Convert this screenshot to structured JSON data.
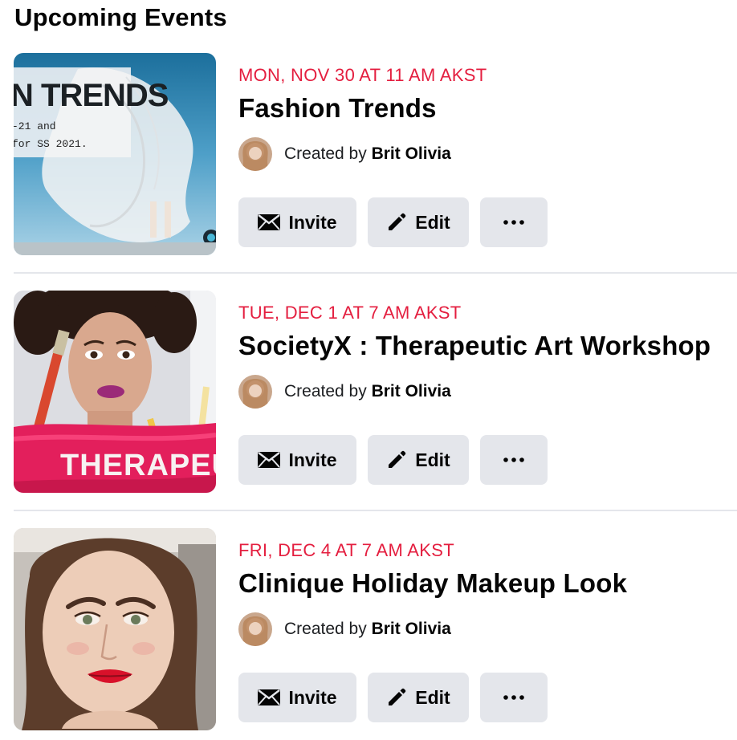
{
  "page": {
    "title": "Upcoming Events"
  },
  "events": [
    {
      "date": "MON, NOV 30 AT 11 AM AKST",
      "title": "Fashion Trends",
      "creator_prefix": "Created by ",
      "creator_name": "Brit Olivia",
      "thumb_text": {
        "heading": "N TRENDS",
        "line1": "-21 and",
        "line2": "for SS 2021."
      },
      "actions": {
        "invite": "Invite",
        "edit": "Edit"
      }
    },
    {
      "date": "TUE, DEC 1 AT 7 AM AKST",
      "title": "SocietyX : Therapeutic Art Workshop",
      "creator_prefix": "Created by ",
      "creator_name": "Brit Olivia",
      "thumb_text": {
        "banner": "THERAPEUT"
      },
      "actions": {
        "invite": "Invite",
        "edit": "Edit"
      }
    },
    {
      "date": "FRI, DEC 4 AT 7 AM AKST",
      "title": "Clinique Holiday Makeup Look",
      "creator_prefix": "Created by ",
      "creator_name": "Brit Olivia",
      "actions": {
        "invite": "Invite",
        "edit": "Edit"
      }
    }
  ],
  "icons": {
    "invite": "envelope-icon",
    "edit": "pencil-icon",
    "more": "ellipsis-icon"
  },
  "colors": {
    "date": "#e41e3f",
    "button_bg": "#e4e6eb",
    "divider": "#e4e6eb"
  }
}
